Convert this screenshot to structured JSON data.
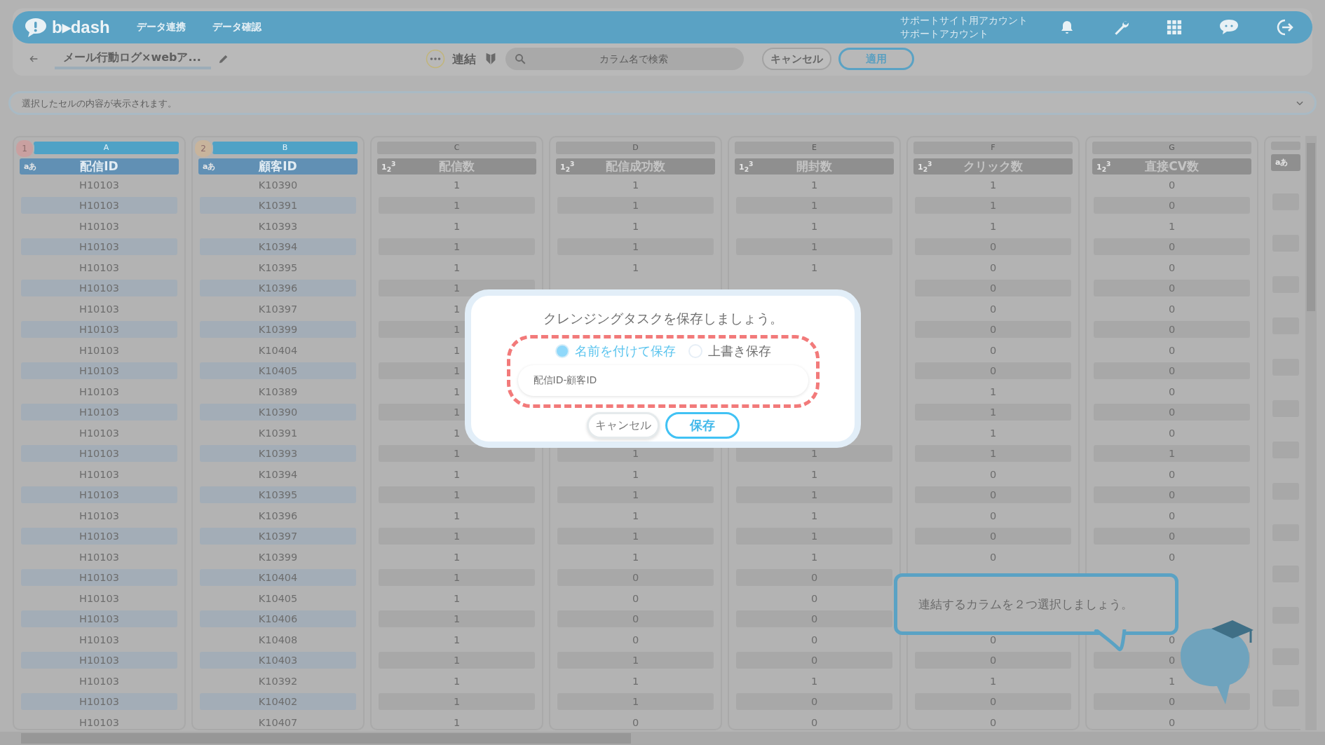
{
  "app_bar": {
    "logo": "b▸dash",
    "nav": [
      {
        "label": "データ連携"
      },
      {
        "label": "データ確認"
      }
    ],
    "account": {
      "line_1": "サポートサイト用アカウント",
      "line_2": "サポートアカウント"
    }
  },
  "toolbar": {
    "title": "メール行動ログ×webア...",
    "operation": "連結",
    "search": {
      "placeholder": "カラム名で検索"
    },
    "buttons": [
      {
        "label": "キャンセル",
        "kind": "plain"
      },
      {
        "label": "適用",
        "kind": "primary"
      }
    ]
  },
  "formula_bar": {
    "placeholder": "選択したセルの内容が表示されます。"
  },
  "table": {
    "columns": [
      {
        "letter": "A",
        "name": "配信ID",
        "type_label": "aあ",
        "selected": true,
        "order": "1"
      },
      {
        "letter": "B",
        "name": "顧客ID",
        "type_label": "aあ",
        "selected": true,
        "order": "2"
      },
      {
        "letter": "C",
        "name": "配信数",
        "type_label": "1$_{2}$$^{3}$",
        "selected": false
      },
      {
        "letter": "D",
        "name": "配信成功数",
        "type_label": "1$_{2}$$^{3}$",
        "selected": false
      },
      {
        "letter": "E",
        "name": "開封数",
        "type_label": "1$_{2}$$^{3}$",
        "selected": false
      },
      {
        "letter": "F",
        "name": "クリック数",
        "type_label": "1$_{2}$$^{3}$",
        "selected": false
      },
      {
        "letter": "G",
        "name": "直接CV数",
        "type_label": "1$_{2}$$^{3}$",
        "selected": false
      },
      {
        "type_label": "aあ",
        "selected": false
      }
    ],
    "rows": [
      [
        "H10103",
        "K10390",
        "1",
        "1",
        "1",
        "1",
        "0"
      ],
      [
        "H10103",
        "K10391",
        "1",
        "1",
        "1",
        "1",
        "0"
      ],
      [
        "H10103",
        "K10393",
        "1",
        "1",
        "1",
        "1",
        "1"
      ],
      [
        "H10103",
        "K10394",
        "1",
        "1",
        "1",
        "0",
        "0"
      ],
      [
        "H10103",
        "K10395",
        "1",
        "1",
        "1",
        "0",
        "0"
      ],
      [
        "H10103",
        "K10396",
        "1",
        null,
        null,
        "0",
        "0"
      ],
      [
        "H10103",
        "K10397",
        "1",
        null,
        null,
        "0",
        "0"
      ],
      [
        "H10103",
        "K10399",
        "1",
        null,
        null,
        "0",
        "0"
      ],
      [
        "H10103",
        "K10404",
        "1",
        null,
        null,
        "0",
        "0"
      ],
      [
        "H10103",
        "K10405",
        "1",
        null,
        null,
        "0",
        "0"
      ],
      [
        "H10103",
        "K10389",
        "1",
        null,
        null,
        "1",
        "0"
      ],
      [
        "H10103",
        "K10390",
        "1",
        null,
        null,
        "1",
        "0"
      ],
      [
        "H10103",
        "K10391",
        "1",
        null,
        null,
        "1",
        "0"
      ],
      [
        "H10103",
        "K10393",
        "1",
        "1",
        "1",
        "1",
        "1"
      ],
      [
        "H10103",
        "K10394",
        "1",
        "1",
        "1",
        "0",
        "0"
      ],
      [
        "H10103",
        "K10395",
        "1",
        "1",
        "1",
        "0",
        "0"
      ],
      [
        "H10103",
        "K10396",
        "1",
        "1",
        "1",
        "0",
        "0"
      ],
      [
        "H10103",
        "K10397",
        "1",
        "1",
        "1",
        "0",
        "0"
      ],
      [
        "H10103",
        "K10399",
        "1",
        "1",
        "1",
        "0",
        "0"
      ],
      [
        "H10103",
        "K10404",
        "1",
        "0",
        "0",
        null,
        null
      ],
      [
        "H10103",
        "K10405",
        "1",
        "0",
        "0",
        null,
        null
      ],
      [
        "H10103",
        "K10406",
        "1",
        "0",
        "0",
        null,
        null
      ],
      [
        "H10103",
        "K10408",
        "1",
        "0",
        "0",
        "0",
        "0"
      ],
      [
        "H10103",
        "K10403",
        "1",
        "1",
        "0",
        "0",
        "0"
      ],
      [
        "H10103",
        "K10392",
        "1",
        "1",
        "1",
        "1",
        "1"
      ],
      [
        "H10103",
        "K10402",
        "1",
        "1",
        "0",
        "0",
        "0"
      ],
      [
        "H10103",
        "K10407",
        "1",
        "0",
        "0",
        "0",
        "0"
      ]
    ]
  },
  "dialog": {
    "title": "クレンジングタスクを保存しましょう。",
    "options": [
      {
        "label": "名前を付けて保存",
        "selected": true
      },
      {
        "label": "上書き保存",
        "selected": false
      }
    ],
    "name_field": {
      "value": "配信ID-顧客ID"
    },
    "buttons": [
      {
        "label": "キャンセル",
        "kind": "plain"
      },
      {
        "label": "保存",
        "kind": "primary"
      }
    ]
  },
  "hint_bubble": {
    "text": "連結するカラムを２つ選択しましょう。"
  }
}
